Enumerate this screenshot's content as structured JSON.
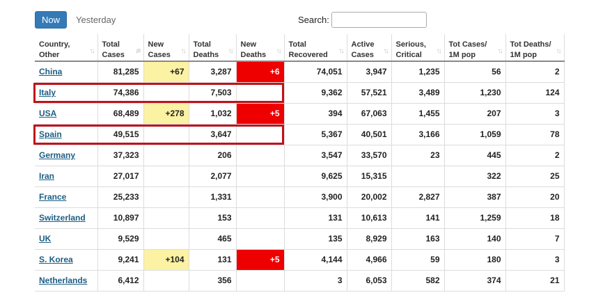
{
  "tabs": {
    "now_label": "Now",
    "yesterday_label": "Yesterday"
  },
  "search": {
    "label": "Search:",
    "value": ""
  },
  "colors": {
    "accent": "#337ab7",
    "new_cases_highlight": "#fbf2a3",
    "new_deaths_highlight": "#ee0000",
    "link": "#1b5e84",
    "annotation_box": "#c0121c"
  },
  "columns": [
    {
      "line1": "Country,",
      "line2": "Other",
      "sort": "sort-both-icon"
    },
    {
      "line1": "Total",
      "line2": "Cases",
      "sort": "sort-desc-icon"
    },
    {
      "line1": "New",
      "line2": "Cases",
      "sort": "sort-both-icon"
    },
    {
      "line1": "Total",
      "line2": "Deaths",
      "sort": "sort-both-icon"
    },
    {
      "line1": "New",
      "line2": "Deaths",
      "sort": "sort-both-icon"
    },
    {
      "line1": "Total",
      "line2": "Recovered",
      "sort": "sort-both-icon"
    },
    {
      "line1": "Active",
      "line2": "Cases",
      "sort": "sort-both-icon"
    },
    {
      "line1": "Serious,",
      "line2": "Critical",
      "sort": "sort-both-icon"
    },
    {
      "line1": "Tot Cases/",
      "line2": "1M pop",
      "sort": "sort-both-icon"
    },
    {
      "line1": "Tot Deaths/",
      "line2": "1M pop",
      "sort": "sort-both-icon"
    }
  ],
  "rows": [
    {
      "country": "China",
      "total_cases": "81,285",
      "new_cases": "+67",
      "total_deaths": "3,287",
      "new_deaths": "+6",
      "total_recovered": "74,051",
      "active_cases": "3,947",
      "serious_critical": "1,235",
      "tot_cases_1m": "56",
      "tot_deaths_1m": "2",
      "boxed": false
    },
    {
      "country": "Italy",
      "total_cases": "74,386",
      "new_cases": "",
      "total_deaths": "7,503",
      "new_deaths": "",
      "total_recovered": "9,362",
      "active_cases": "57,521",
      "serious_critical": "3,489",
      "tot_cases_1m": "1,230",
      "tot_deaths_1m": "124",
      "boxed": true
    },
    {
      "country": "USA",
      "total_cases": "68,489",
      "new_cases": "+278",
      "total_deaths": "1,032",
      "new_deaths": "+5",
      "total_recovered": "394",
      "active_cases": "67,063",
      "serious_critical": "1,455",
      "tot_cases_1m": "207",
      "tot_deaths_1m": "3",
      "boxed": false
    },
    {
      "country": "Spain",
      "total_cases": "49,515",
      "new_cases": "",
      "total_deaths": "3,647",
      "new_deaths": "",
      "total_recovered": "5,367",
      "active_cases": "40,501",
      "serious_critical": "3,166",
      "tot_cases_1m": "1,059",
      "tot_deaths_1m": "78",
      "boxed": true
    },
    {
      "country": "Germany",
      "total_cases": "37,323",
      "new_cases": "",
      "total_deaths": "206",
      "new_deaths": "",
      "total_recovered": "3,547",
      "active_cases": "33,570",
      "serious_critical": "23",
      "tot_cases_1m": "445",
      "tot_deaths_1m": "2",
      "boxed": false
    },
    {
      "country": "Iran",
      "total_cases": "27,017",
      "new_cases": "",
      "total_deaths": "2,077",
      "new_deaths": "",
      "total_recovered": "9,625",
      "active_cases": "15,315",
      "serious_critical": "",
      "tot_cases_1m": "322",
      "tot_deaths_1m": "25",
      "boxed": false
    },
    {
      "country": "France",
      "total_cases": "25,233",
      "new_cases": "",
      "total_deaths": "1,331",
      "new_deaths": "",
      "total_recovered": "3,900",
      "active_cases": "20,002",
      "serious_critical": "2,827",
      "tot_cases_1m": "387",
      "tot_deaths_1m": "20",
      "boxed": false
    },
    {
      "country": "Switzerland",
      "total_cases": "10,897",
      "new_cases": "",
      "total_deaths": "153",
      "new_deaths": "",
      "total_recovered": "131",
      "active_cases": "10,613",
      "serious_critical": "141",
      "tot_cases_1m": "1,259",
      "tot_deaths_1m": "18",
      "boxed": false
    },
    {
      "country": "UK",
      "total_cases": "9,529",
      "new_cases": "",
      "total_deaths": "465",
      "new_deaths": "",
      "total_recovered": "135",
      "active_cases": "8,929",
      "serious_critical": "163",
      "tot_cases_1m": "140",
      "tot_deaths_1m": "7",
      "boxed": false
    },
    {
      "country": "S. Korea",
      "total_cases": "9,241",
      "new_cases": "+104",
      "total_deaths": "131",
      "new_deaths": "+5",
      "total_recovered": "4,144",
      "active_cases": "4,966",
      "serious_critical": "59",
      "tot_cases_1m": "180",
      "tot_deaths_1m": "3",
      "boxed": false
    },
    {
      "country": "Netherlands",
      "total_cases": "6,412",
      "new_cases": "",
      "total_deaths": "356",
      "new_deaths": "",
      "total_recovered": "3",
      "active_cases": "6,053",
      "serious_critical": "582",
      "tot_cases_1m": "374",
      "tot_deaths_1m": "21",
      "boxed": false
    }
  ]
}
